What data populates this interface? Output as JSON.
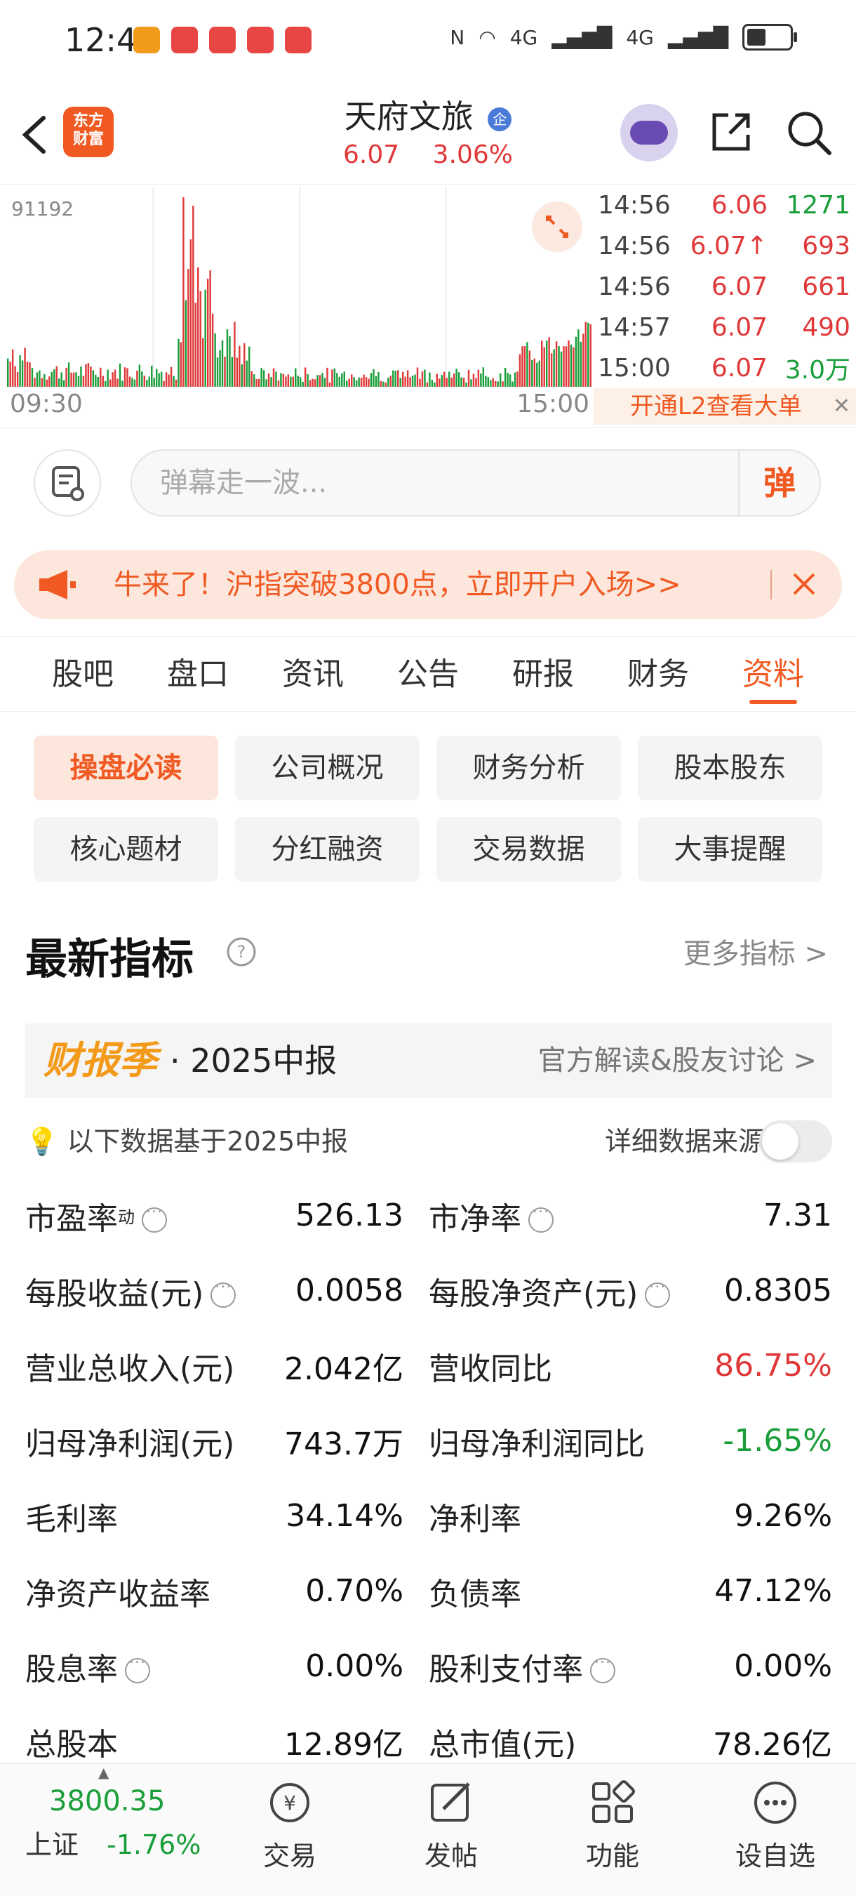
{
  "status": {
    "time": "12:46",
    "net": "4G"
  },
  "header": {
    "logo_line1": "东方",
    "logo_line2": "财富",
    "title": "天府文旅",
    "badge": "企",
    "price": "6.07",
    "change": "3.06%"
  },
  "chart": {
    "peak_label": "91192",
    "x_start": "09:30",
    "x_end": "15:00",
    "ticks": [
      {
        "time": "14:56",
        "price": "6.06",
        "vol": "1271",
        "vol_color": "#1a9e3a"
      },
      {
        "time": "14:56",
        "price": "6.07↑",
        "vol": "693",
        "vol_color": "#e03838"
      },
      {
        "time": "14:56",
        "price": "6.07",
        "vol": "661",
        "vol_color": "#e03838"
      },
      {
        "time": "14:57",
        "price": "6.07",
        "vol": "490",
        "vol_color": "#e03838"
      },
      {
        "time": "15:00",
        "price": "6.07",
        "vol": "3.0万",
        "vol_color": "#1a9e3a"
      }
    ],
    "l2_text": "开通L2查看大单",
    "colors": {
      "up": "#e03838",
      "down": "#1a9e3a"
    }
  },
  "danmu": {
    "placeholder": "弹幕走一波...",
    "send": "弹"
  },
  "banner": {
    "text": "牛来了！沪指突破3800点，立即开户入场>>"
  },
  "tabs": [
    {
      "label": "股吧"
    },
    {
      "label": "盘口"
    },
    {
      "label": "资讯"
    },
    {
      "label": "公告"
    },
    {
      "label": "研报"
    },
    {
      "label": "财务"
    },
    {
      "label": "资料"
    }
  ],
  "subtabs": [
    "操盘必读",
    "公司概况",
    "财务分析",
    "股本股东",
    "核心题材",
    "分红融资",
    "交易数据",
    "大事提醒"
  ],
  "indicators": {
    "title": "最新指标",
    "more": "更多指标 >",
    "season_badge": "财报季",
    "season_report": "· 2025中报",
    "official": "官方解读&股友讨论 >",
    "basis": "以下数据基于2025中报",
    "source": "详细数据来源",
    "rows": [
      [
        {
          "label": "市盈率",
          "sup": "动",
          "info": true,
          "value": "526.13",
          "tone": ""
        },
        {
          "label": "市净率",
          "info": true,
          "value": "7.31",
          "tone": ""
        }
      ],
      [
        {
          "label": "每股收益(元)",
          "info": true,
          "value": "0.0058",
          "tone": ""
        },
        {
          "label": "每股净资产(元)",
          "info": true,
          "value": "0.8305",
          "tone": ""
        }
      ],
      [
        {
          "label": "营业总收入(元)",
          "value": "2.042亿",
          "tone": ""
        },
        {
          "label": "营收同比",
          "value": "86.75%",
          "tone": "red"
        }
      ],
      [
        {
          "label": "归母净利润(元)",
          "value": "743.7万",
          "tone": ""
        },
        {
          "label": "归母净利润同比",
          "value": "-1.65%",
          "tone": "green"
        }
      ],
      [
        {
          "label": "毛利率",
          "value": "34.14%",
          "tone": ""
        },
        {
          "label": "净利率",
          "value": "9.26%",
          "tone": ""
        }
      ],
      [
        {
          "label": "净资产收益率",
          "value": "0.70%",
          "tone": ""
        },
        {
          "label": "负债率",
          "value": "47.12%",
          "tone": ""
        }
      ],
      [
        {
          "label": "股息率",
          "info": true,
          "value": "0.00%",
          "tone": ""
        },
        {
          "label": "股利支付率",
          "info": true,
          "value": "0.00%",
          "tone": ""
        }
      ],
      [
        {
          "label": "总股本",
          "value": "12.89亿",
          "tone": ""
        },
        {
          "label": "总市值(元)",
          "value": "78.26亿",
          "tone": ""
        }
      ]
    ]
  },
  "bottom": {
    "index_value": "3800.35",
    "index_name": "上证",
    "index_change": "-1.76%",
    "nav": [
      "交易",
      "发帖",
      "功能",
      "设自选"
    ]
  }
}
